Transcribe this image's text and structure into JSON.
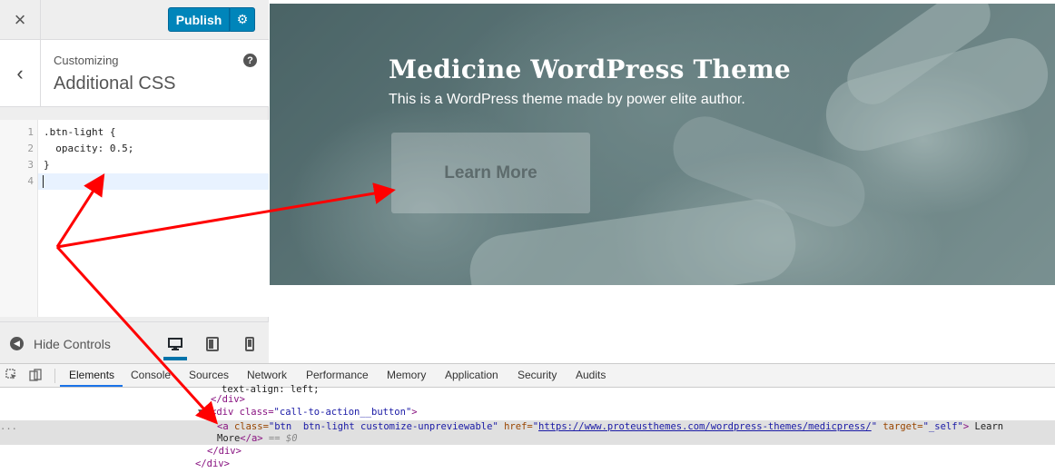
{
  "topbar": {
    "close_icon": "×",
    "publish_label": "Publish",
    "settings_icon": "⚙"
  },
  "section": {
    "back_icon": "‹",
    "breadcrumb": "Customizing",
    "title": "Additional CSS",
    "help_icon": "?"
  },
  "editor": {
    "line_numbers": [
      "1",
      "2",
      "3",
      "4"
    ],
    "lines": [
      ".btn-light {",
      "  opacity: 0.5;",
      "}",
      ""
    ]
  },
  "footer": {
    "hide_controls_label": "Hide Controls",
    "devices": [
      "desktop",
      "tablet",
      "mobile"
    ],
    "active_device": "desktop"
  },
  "preview": {
    "title": "Medicine WordPress Theme",
    "subtitle": "This is a WordPress theme made by power elite author.",
    "button_label": "Learn More"
  },
  "devtools": {
    "tabs": [
      "Elements",
      "Console",
      "Sources",
      "Network",
      "Performance",
      "Memory",
      "Application",
      "Security",
      "Audits"
    ],
    "active_tab": "Elements",
    "dom_lines": {
      "line0": "text-align: left;",
      "line1": "</div>",
      "line2_open": "<div class=",
      "line2_val": "\"call-to-action__button\"",
      "line2_close": ">",
      "a_open": "<a ",
      "a_class_attr": "class=",
      "a_class_val": "\"btn  btn-light customize-unpreviewable\"",
      "a_href_attr": " href=",
      "a_href_quote_open": "\"",
      "a_href_val": "https://www.proteusthemes.com/wordpress-themes/medicpress/",
      "a_href_quote_close": "\"",
      "a_target_attr": " target=",
      "a_target_val": "\"_self\"",
      "a_close": ">",
      "a_text_1": " Learn",
      "a_text_2": "More",
      "a_end": "</a>",
      "a_eq": " == $0",
      "line5": "</div>",
      "line6": "</div>",
      "dots": "..."
    }
  },
  "colors": {
    "publish": "#0085ba",
    "arrow": "#ff0000",
    "active_tab_underline": "#1a73e8"
  }
}
